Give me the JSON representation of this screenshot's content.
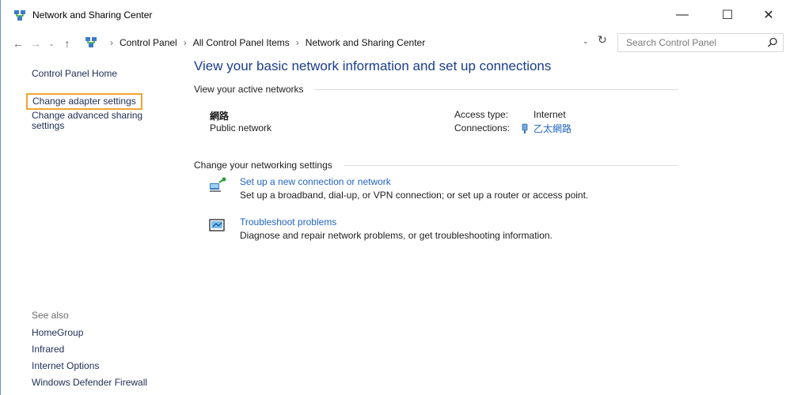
{
  "window": {
    "title": "Network and Sharing Center",
    "minimize_glyph": "—",
    "maximize_glyph": "☐",
    "close_glyph": "✕"
  },
  "address_bar": {
    "back_glyph": "←",
    "forward_glyph": "→",
    "recent_glyph": "⌄",
    "up_glyph": "↑",
    "sep_glyph": "›",
    "crumbs": [
      "Control Panel",
      "All Control Panel Items",
      "Network and Sharing Center"
    ],
    "dropdown_glyph": "⌄",
    "refresh_glyph": "↻"
  },
  "search": {
    "placeholder": "Search Control Panel"
  },
  "left_pane": {
    "home": "Control Panel Home",
    "adapter": "Change adapter settings",
    "sharing_line1": "Change advanced sharing",
    "sharing_line2": "settings",
    "see_also_title": "See also",
    "see_also": [
      "HomeGroup",
      "Infrared",
      "Internet Options",
      "Windows Defender Firewall"
    ]
  },
  "main": {
    "title": "View your basic network information and set up connections",
    "active_networks_heading": "View your active networks",
    "network": {
      "name": "網路",
      "category": "Public network",
      "access_type_label": "Access type:",
      "access_type_value": "Internet",
      "connections_label": "Connections:",
      "connection_name": "乙太網路"
    },
    "change_settings_heading": "Change your networking settings",
    "tasks": [
      {
        "link": "Set up a new connection or network",
        "desc": "Set up a broadband, dial-up, or VPN connection; or set up a router or access point."
      },
      {
        "link": "Troubleshoot problems",
        "desc": "Diagnose and repair network problems, or get troubleshooting information."
      }
    ]
  },
  "colors": {
    "accent_link": "#2166c4",
    "title_blue": "#1a3d8f",
    "highlight_border": "#f2a531"
  },
  "icons": {
    "app": "network-and-sharing-center-icon",
    "search": "search-icon",
    "connection": "ethernet-adapter-icon",
    "new_connection": "new-connection-icon",
    "troubleshoot": "troubleshoot-icon"
  }
}
